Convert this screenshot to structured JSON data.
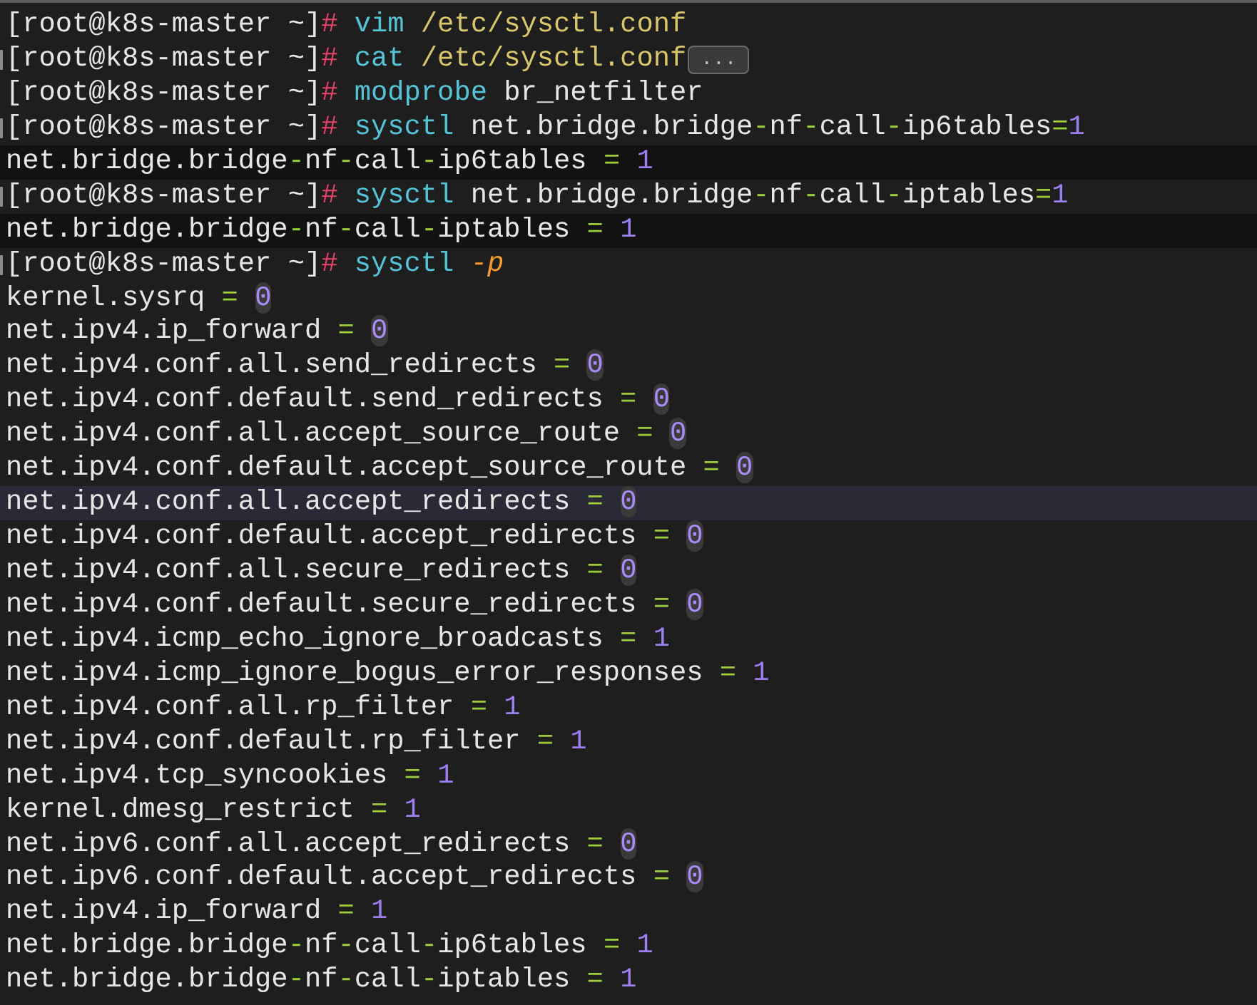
{
  "terminal": {
    "lines": [
      {
        "marker": false,
        "shaded": false,
        "hover": false,
        "spans": [
          {
            "text": "[root@k8s-master ~]",
            "kind": "prompt"
          },
          {
            "text": "#",
            "kind": "hash"
          },
          {
            "text": " vim",
            "kind": "command"
          },
          {
            "text": " /etc/sysctl.conf",
            "kind": "path"
          }
        ]
      },
      {
        "marker": true,
        "shaded": false,
        "hover": false,
        "spans": [
          {
            "text": "[root@k8s-master ~]",
            "kind": "prompt"
          },
          {
            "text": "#",
            "kind": "hash"
          },
          {
            "text": " cat",
            "kind": "command"
          },
          {
            "text": " /etc/sysctl.conf",
            "kind": "path"
          }
        ],
        "fold": "..."
      },
      {
        "marker": false,
        "shaded": false,
        "hover": false,
        "spans": [
          {
            "text": "[root@k8s-master ~]",
            "kind": "prompt"
          },
          {
            "text": "#",
            "kind": "hash"
          },
          {
            "text": " modprobe",
            "kind": "command"
          },
          {
            "text": " br_netfilter",
            "kind": "plain"
          }
        ]
      },
      {
        "marker": true,
        "shaded": false,
        "hover": false,
        "spans": [
          {
            "text": "[root@k8s-master ~]",
            "kind": "prompt"
          },
          {
            "text": "#",
            "kind": "hash"
          },
          {
            "text": " sysctl",
            "kind": "command"
          },
          {
            "text": " net.bridge.bridge",
            "kind": "plain"
          },
          {
            "text": "-",
            "kind": "op"
          },
          {
            "text": "nf",
            "kind": "plain"
          },
          {
            "text": "-",
            "kind": "op"
          },
          {
            "text": "call",
            "kind": "plain"
          },
          {
            "text": "-",
            "kind": "op"
          },
          {
            "text": "ip6tables",
            "kind": "plain"
          },
          {
            "text": "=",
            "kind": "op"
          },
          {
            "text": "1",
            "kind": "number"
          }
        ]
      },
      {
        "marker": false,
        "shaded": true,
        "hover": false,
        "spans": [
          {
            "text": "net.bridge.bridge",
            "kind": "plain"
          },
          {
            "text": "-",
            "kind": "op"
          },
          {
            "text": "nf",
            "kind": "plain"
          },
          {
            "text": "-",
            "kind": "op"
          },
          {
            "text": "call",
            "kind": "plain"
          },
          {
            "text": "-",
            "kind": "op"
          },
          {
            "text": "ip6tables",
            "kind": "plain"
          },
          {
            "text": " = ",
            "kind": "op"
          },
          {
            "text": "1",
            "kind": "number"
          }
        ]
      },
      {
        "marker": true,
        "shaded": false,
        "hover": false,
        "spans": [
          {
            "text": "[root@k8s-master ~]",
            "kind": "prompt"
          },
          {
            "text": "#",
            "kind": "hash"
          },
          {
            "text": " sysctl",
            "kind": "command"
          },
          {
            "text": " net.bridge.bridge",
            "kind": "plain"
          },
          {
            "text": "-",
            "kind": "op"
          },
          {
            "text": "nf",
            "kind": "plain"
          },
          {
            "text": "-",
            "kind": "op"
          },
          {
            "text": "call",
            "kind": "plain"
          },
          {
            "text": "-",
            "kind": "op"
          },
          {
            "text": "iptables",
            "kind": "plain"
          },
          {
            "text": "=",
            "kind": "op"
          },
          {
            "text": "1",
            "kind": "number"
          }
        ]
      },
      {
        "marker": false,
        "shaded": true,
        "hover": false,
        "spans": [
          {
            "text": "net.bridge.bridge",
            "kind": "plain"
          },
          {
            "text": "-",
            "kind": "op"
          },
          {
            "text": "nf",
            "kind": "plain"
          },
          {
            "text": "-",
            "kind": "op"
          },
          {
            "text": "call",
            "kind": "plain"
          },
          {
            "text": "-",
            "kind": "op"
          },
          {
            "text": "iptables",
            "kind": "plain"
          },
          {
            "text": " = ",
            "kind": "op"
          },
          {
            "text": "1",
            "kind": "number"
          }
        ]
      },
      {
        "marker": true,
        "shaded": false,
        "hover": false,
        "spans": [
          {
            "text": "[root@k8s-master ~]",
            "kind": "prompt"
          },
          {
            "text": "#",
            "kind": "hash"
          },
          {
            "text": " sysctl",
            "kind": "command"
          },
          {
            "text": " -p",
            "kind": "flag"
          }
        ]
      },
      {
        "marker": false,
        "shaded": false,
        "hover": false,
        "spans": [
          {
            "text": "kernel.sysrq",
            "kind": "plain"
          },
          {
            "text": " = ",
            "kind": "op"
          },
          {
            "text": "0",
            "kind": "zero"
          }
        ]
      },
      {
        "marker": false,
        "shaded": false,
        "hover": false,
        "spans": [
          {
            "text": "net.ipv4.ip_forward",
            "kind": "plain"
          },
          {
            "text": " = ",
            "kind": "op"
          },
          {
            "text": "0",
            "kind": "zero"
          }
        ]
      },
      {
        "marker": false,
        "shaded": false,
        "hover": false,
        "spans": [
          {
            "text": "net.ipv4.conf.all.send_redirects",
            "kind": "plain"
          },
          {
            "text": " = ",
            "kind": "op"
          },
          {
            "text": "0",
            "kind": "zero"
          }
        ]
      },
      {
        "marker": false,
        "shaded": false,
        "hover": false,
        "spans": [
          {
            "text": "net.ipv4.conf.default.send_redirects",
            "kind": "plain"
          },
          {
            "text": " = ",
            "kind": "op"
          },
          {
            "text": "0",
            "kind": "zero"
          }
        ]
      },
      {
        "marker": false,
        "shaded": false,
        "hover": false,
        "spans": [
          {
            "text": "net.ipv4.conf.all.accept_source_route",
            "kind": "plain"
          },
          {
            "text": " = ",
            "kind": "op"
          },
          {
            "text": "0",
            "kind": "zero"
          }
        ]
      },
      {
        "marker": false,
        "shaded": false,
        "hover": false,
        "spans": [
          {
            "text": "net.ipv4.conf.default.accept_source_route",
            "kind": "plain"
          },
          {
            "text": " = ",
            "kind": "op"
          },
          {
            "text": "0",
            "kind": "zero"
          }
        ]
      },
      {
        "marker": false,
        "shaded": false,
        "hover": true,
        "spans": [
          {
            "text": "net.ipv4.conf.all.accept_redirects",
            "kind": "plain"
          },
          {
            "text": " = ",
            "kind": "op"
          },
          {
            "text": "0",
            "kind": "zero"
          }
        ]
      },
      {
        "marker": false,
        "shaded": false,
        "hover": false,
        "spans": [
          {
            "text": "net.ipv4.conf.default.accept_redirects",
            "kind": "plain"
          },
          {
            "text": " = ",
            "kind": "op"
          },
          {
            "text": "0",
            "kind": "zero"
          }
        ]
      },
      {
        "marker": false,
        "shaded": false,
        "hover": false,
        "spans": [
          {
            "text": "net.ipv4.conf.all.secure_redirects",
            "kind": "plain"
          },
          {
            "text": " = ",
            "kind": "op"
          },
          {
            "text": "0",
            "kind": "zero"
          }
        ]
      },
      {
        "marker": false,
        "shaded": false,
        "hover": false,
        "spans": [
          {
            "text": "net.ipv4.conf.default.secure_redirects",
            "kind": "plain"
          },
          {
            "text": " = ",
            "kind": "op"
          },
          {
            "text": "0",
            "kind": "zero"
          }
        ]
      },
      {
        "marker": false,
        "shaded": false,
        "hover": false,
        "spans": [
          {
            "text": "net.ipv4.icmp_echo_ignore_broadcasts",
            "kind": "plain"
          },
          {
            "text": " = ",
            "kind": "op"
          },
          {
            "text": "1",
            "kind": "number"
          }
        ]
      },
      {
        "marker": false,
        "shaded": false,
        "hover": false,
        "spans": [
          {
            "text": "net.ipv4.icmp_ignore_bogus_error_responses",
            "kind": "plain"
          },
          {
            "text": " = ",
            "kind": "op"
          },
          {
            "text": "1",
            "kind": "number"
          }
        ]
      },
      {
        "marker": false,
        "shaded": false,
        "hover": false,
        "spans": [
          {
            "text": "net.ipv4.conf.all.rp_filter",
            "kind": "plain"
          },
          {
            "text": " = ",
            "kind": "op"
          },
          {
            "text": "1",
            "kind": "number"
          }
        ]
      },
      {
        "marker": false,
        "shaded": false,
        "hover": false,
        "spans": [
          {
            "text": "net.ipv4.conf.default.rp_filter",
            "kind": "plain"
          },
          {
            "text": " = ",
            "kind": "op"
          },
          {
            "text": "1",
            "kind": "number"
          }
        ]
      },
      {
        "marker": false,
        "shaded": false,
        "hover": false,
        "spans": [
          {
            "text": "net.ipv4.tcp_syncookies",
            "kind": "plain"
          },
          {
            "text": " = ",
            "kind": "op"
          },
          {
            "text": "1",
            "kind": "number"
          }
        ]
      },
      {
        "marker": false,
        "shaded": false,
        "hover": false,
        "spans": [
          {
            "text": "kernel.dmesg_restrict",
            "kind": "plain"
          },
          {
            "text": " = ",
            "kind": "op"
          },
          {
            "text": "1",
            "kind": "number"
          }
        ]
      },
      {
        "marker": false,
        "shaded": false,
        "hover": false,
        "spans": [
          {
            "text": "net.ipv6.conf.all.accept_redirects",
            "kind": "plain"
          },
          {
            "text": " = ",
            "kind": "op"
          },
          {
            "text": "0",
            "kind": "zero"
          }
        ]
      },
      {
        "marker": false,
        "shaded": false,
        "hover": false,
        "spans": [
          {
            "text": "net.ipv6.conf.default.accept_redirects",
            "kind": "plain"
          },
          {
            "text": " = ",
            "kind": "op"
          },
          {
            "text": "0",
            "kind": "zero"
          }
        ]
      },
      {
        "marker": false,
        "shaded": false,
        "hover": false,
        "spans": [
          {
            "text": "net.ipv4.ip_forward",
            "kind": "plain"
          },
          {
            "text": " = ",
            "kind": "op"
          },
          {
            "text": "1",
            "kind": "number"
          }
        ]
      },
      {
        "marker": false,
        "shaded": false,
        "hover": false,
        "spans": [
          {
            "text": "net.bridge.bridge",
            "kind": "plain"
          },
          {
            "text": "-",
            "kind": "op"
          },
          {
            "text": "nf",
            "kind": "plain"
          },
          {
            "text": "-",
            "kind": "op"
          },
          {
            "text": "call",
            "kind": "plain"
          },
          {
            "text": "-",
            "kind": "op"
          },
          {
            "text": "ip6tables",
            "kind": "plain"
          },
          {
            "text": " = ",
            "kind": "op"
          },
          {
            "text": "1",
            "kind": "number"
          }
        ]
      },
      {
        "marker": false,
        "shaded": false,
        "hover": false,
        "spans": [
          {
            "text": "net.bridge.bridge",
            "kind": "plain"
          },
          {
            "text": "-",
            "kind": "op"
          },
          {
            "text": "nf",
            "kind": "plain"
          },
          {
            "text": "-",
            "kind": "op"
          },
          {
            "text": "call",
            "kind": "plain"
          },
          {
            "text": "-",
            "kind": "op"
          },
          {
            "text": "iptables",
            "kind": "plain"
          },
          {
            "text": " = ",
            "kind": "op"
          },
          {
            "text": "1",
            "kind": "number"
          }
        ]
      }
    ]
  }
}
